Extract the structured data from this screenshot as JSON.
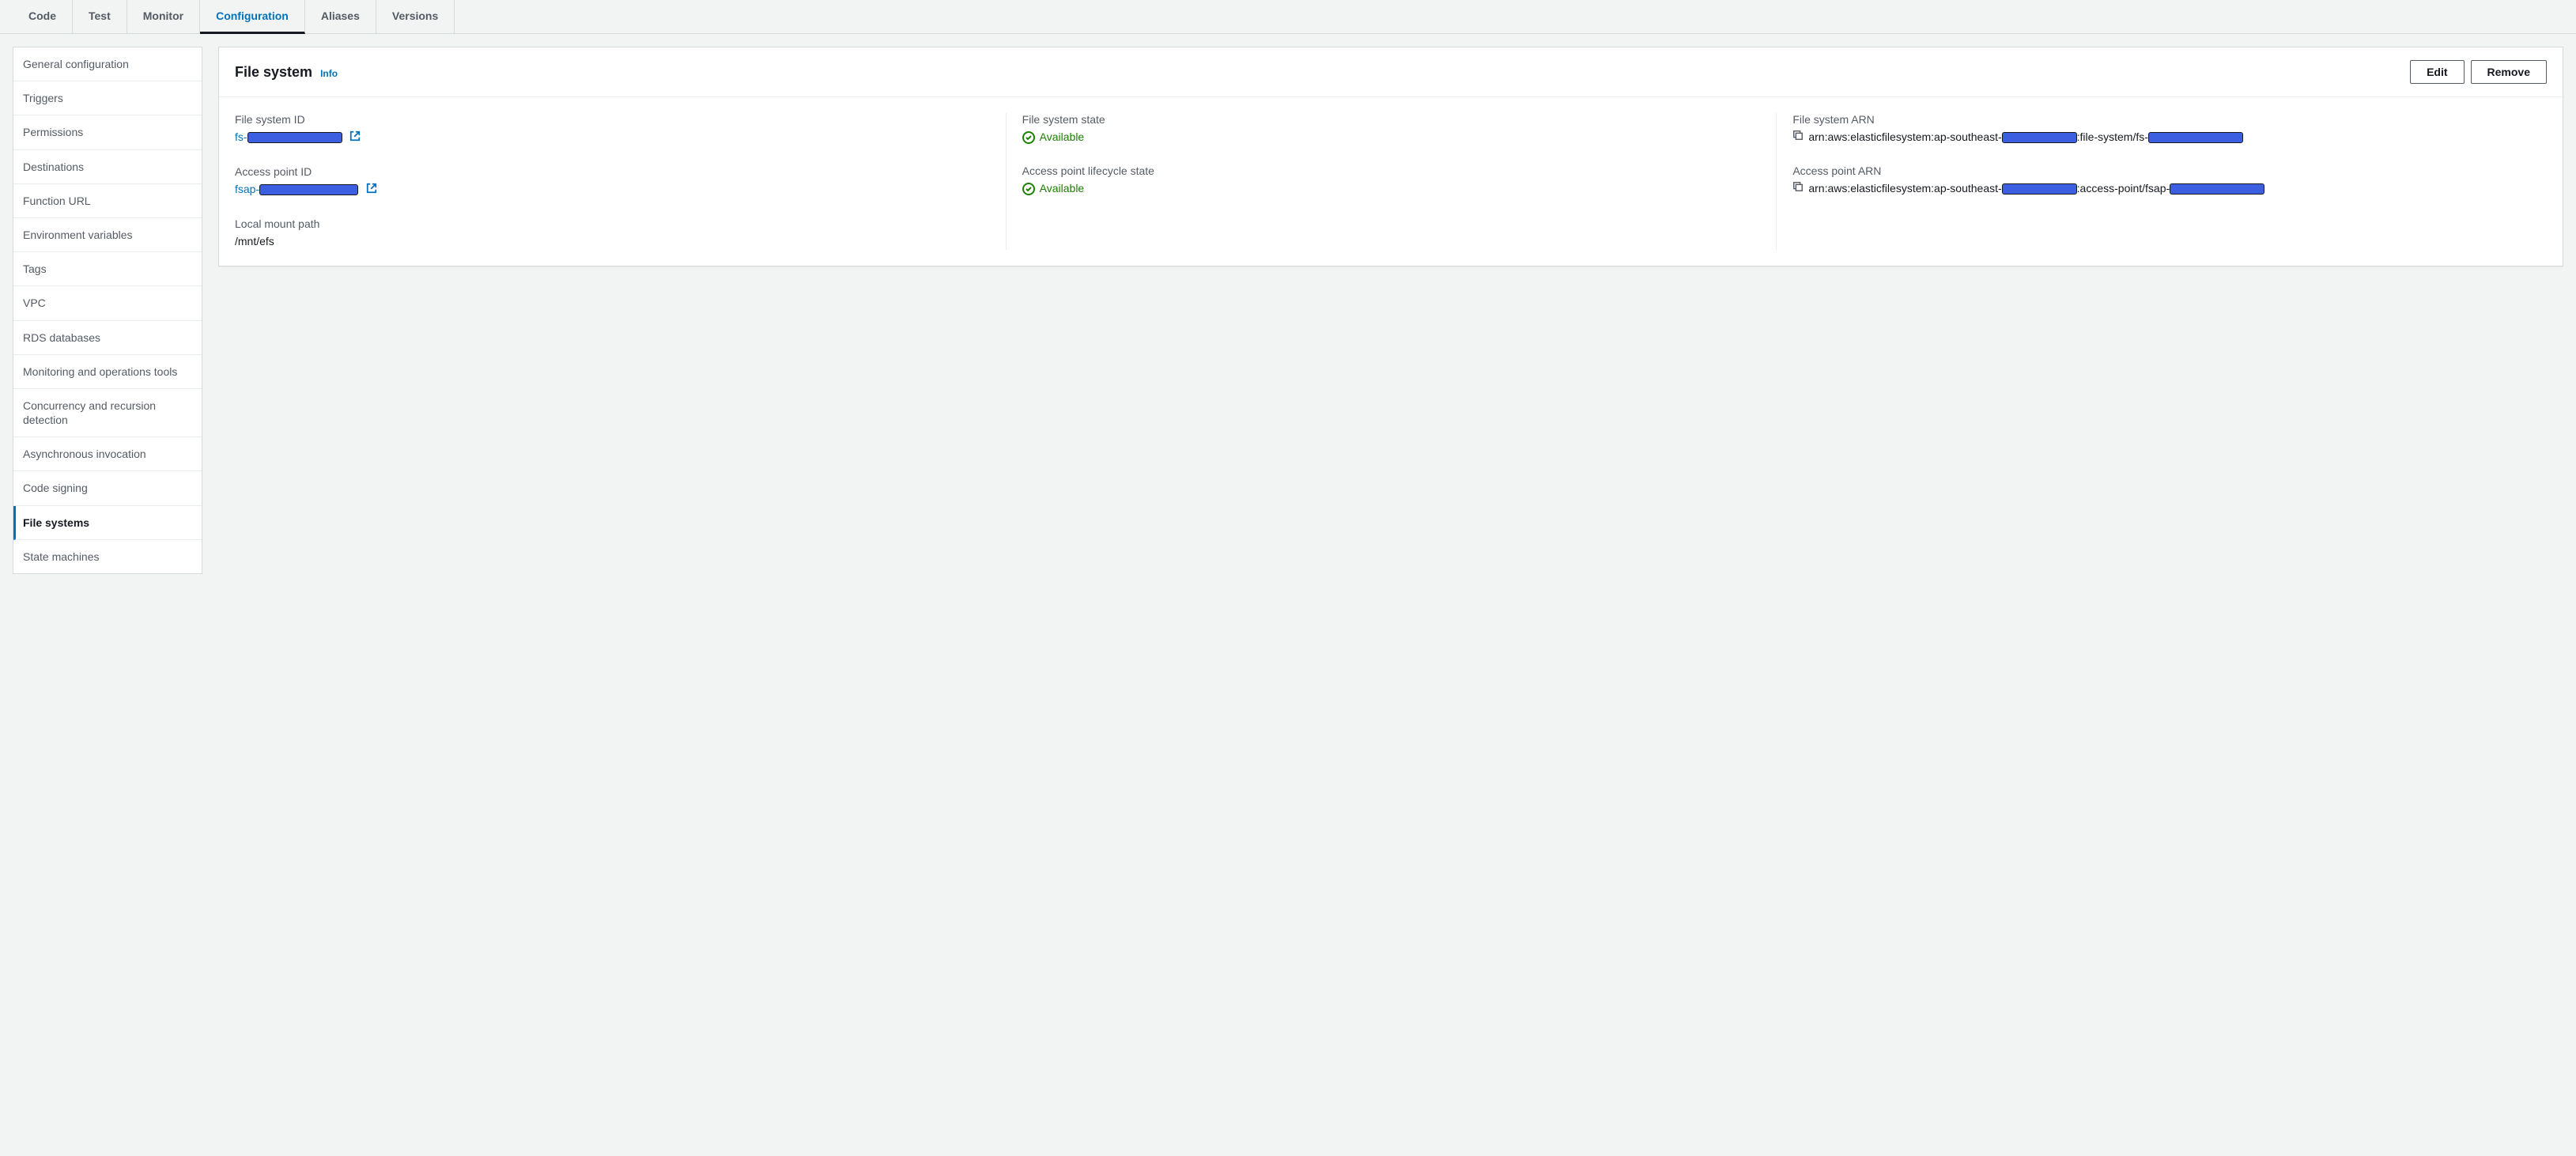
{
  "tabs": [
    "Code",
    "Test",
    "Monitor",
    "Configuration",
    "Aliases",
    "Versions"
  ],
  "activeTab": "Configuration",
  "sidebar": {
    "items": [
      "General configuration",
      "Triggers",
      "Permissions",
      "Destinations",
      "Function URL",
      "Environment variables",
      "Tags",
      "VPC",
      "RDS databases",
      "Monitoring and operations tools",
      "Concurrency and recursion detection",
      "Asynchronous invocation",
      "Code signing",
      "File systems",
      "State machines"
    ],
    "active": "File systems"
  },
  "panel": {
    "title": "File system",
    "infoLabel": "Info",
    "actions": {
      "edit": "Edit",
      "remove": "Remove"
    },
    "fields": {
      "fsId": {
        "label": "File system ID",
        "prefix": "fs-"
      },
      "apId": {
        "label": "Access point ID",
        "prefix": "fsap-"
      },
      "mount": {
        "label": "Local mount path",
        "value": "/mnt/efs"
      },
      "fsState": {
        "label": "File system state",
        "value": "Available"
      },
      "apState": {
        "label": "Access point lifecycle state",
        "value": "Available"
      },
      "fsArn": {
        "label": "File system ARN",
        "prefix": "arn:aws:elasticfilesystem:ap-southeast-",
        "mid": ":file-system/fs-"
      },
      "apArn": {
        "label": "Access point ARN",
        "prefix": "arn:aws:elasticfilesystem:ap-southeast-",
        "mid": ":access-point/fsap-"
      }
    }
  }
}
